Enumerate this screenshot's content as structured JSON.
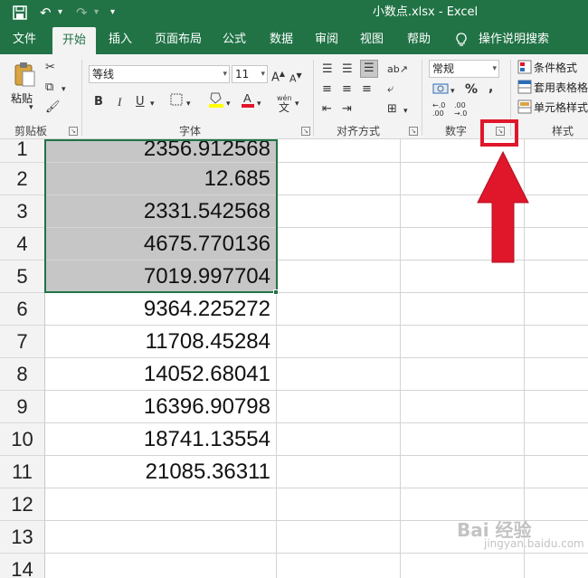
{
  "window": {
    "title": "小数点.xlsx  -  Excel"
  },
  "quick_access": {
    "save_icon": "save-icon",
    "undo": "↶",
    "redo": "↷",
    "more": "▾"
  },
  "tabs": [
    "文件",
    "开始",
    "插入",
    "页面布局",
    "公式",
    "数据",
    "审阅",
    "视图",
    "帮助"
  ],
  "tell_me": "操作说明搜索",
  "ribbon": {
    "clipboard": {
      "paste_label": "粘贴",
      "group_label": "剪贴板"
    },
    "font": {
      "name": "等线",
      "size": "11",
      "bold": "B",
      "italic": "I",
      "underline": "U",
      "phonetic": "wén",
      "group_label": "字体"
    },
    "alignment": {
      "group_label": "对齐方式"
    },
    "number": {
      "format": "常规",
      "percent": "%",
      "comma": ",",
      "inc_decimal": "←.0 .00",
      "dec_decimal": ".00 →.0",
      "group_label": "数字"
    },
    "styles": {
      "conditional": "条件格式",
      "table_format": "套用表格格",
      "cell_styles": "单元格样式",
      "group_label": "样式"
    }
  },
  "rows": [
    {
      "num": "1",
      "value": "2356.912568"
    },
    {
      "num": "2",
      "value": "12.685"
    },
    {
      "num": "3",
      "value": "2331.542568"
    },
    {
      "num": "4",
      "value": "4675.770136"
    },
    {
      "num": "5",
      "value": "7019.997704"
    },
    {
      "num": "6",
      "value": "9364.225272"
    },
    {
      "num": "7",
      "value": "11708.45284"
    },
    {
      "num": "8",
      "value": "14052.68041"
    },
    {
      "num": "9",
      "value": "16396.90798"
    },
    {
      "num": "10",
      "value": "18741.13554"
    },
    {
      "num": "11",
      "value": "21085.36311"
    },
    {
      "num": "12",
      "value": ""
    },
    {
      "num": "13",
      "value": ""
    },
    {
      "num": "14",
      "value": ""
    }
  ],
  "selected_rows": [
    "1",
    "2",
    "3",
    "4",
    "5"
  ],
  "colors": {
    "excel_green": "#217346",
    "annotation_red": "#e0162b"
  },
  "watermark": {
    "text": "Bai 经验",
    "sub": "jingyan.baidu.com"
  }
}
